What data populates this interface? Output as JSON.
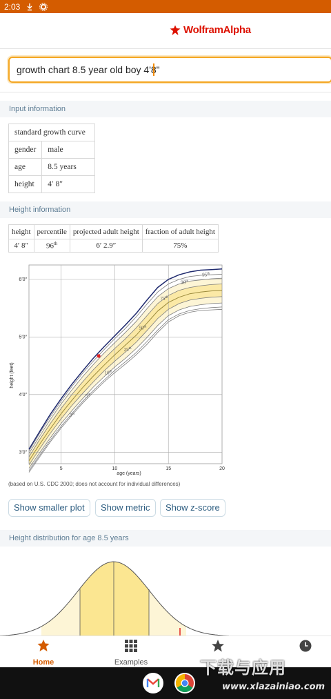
{
  "status": {
    "time": "2:03"
  },
  "logo": {
    "name": "WolframAlpha"
  },
  "search": {
    "value": "growth chart 8.5 year old boy 4'8\""
  },
  "input_pod": {
    "title": "Input information",
    "header": "standard growth curve",
    "rows": [
      {
        "label": "gender",
        "value": "male"
      },
      {
        "label": "age",
        "value": "8.5 years"
      },
      {
        "label": "height",
        "value": "4′ 8″"
      }
    ]
  },
  "height_pod": {
    "title": "Height information",
    "headers": [
      "height",
      "percentile",
      "projected adult height",
      "fraction of adult height"
    ],
    "row": [
      "4′ 8″",
      "96",
      "th",
      "6′ 2.9″",
      "75%"
    ]
  },
  "chart_data": {
    "type": "line",
    "xlabel": "age (years)",
    "ylabel": "height (feet)",
    "xlim": [
      2,
      20
    ],
    "ylim": [
      2.8,
      6.25
    ],
    "xticks": [
      "5",
      "10",
      "15",
      "20"
    ],
    "yticks": [
      "3′0″",
      "4′0″",
      "5′0″",
      "6′0″"
    ],
    "percentile_labels": [
      "3",
      "5",
      "10",
      "25",
      "50",
      "75",
      "90",
      "95"
    ],
    "percentile_suffix": "th",
    "x": [
      2,
      3,
      4,
      5,
      6,
      7,
      8,
      9,
      10,
      11,
      12,
      13,
      14,
      15,
      16,
      17,
      18,
      19,
      20
    ],
    "series": [
      {
        "name": "3",
        "values": [
          2.65,
          2.92,
          3.18,
          3.42,
          3.64,
          3.85,
          4.04,
          4.22,
          4.38,
          4.53,
          4.69,
          4.87,
          5.08,
          5.26,
          5.37,
          5.43,
          5.46,
          5.47,
          5.48
        ]
      },
      {
        "name": "5",
        "values": [
          2.68,
          2.95,
          3.21,
          3.45,
          3.67,
          3.88,
          4.07,
          4.25,
          4.42,
          4.57,
          4.73,
          4.92,
          5.12,
          5.3,
          5.4,
          5.46,
          5.49,
          5.51,
          5.52
        ]
      },
      {
        "name": "10",
        "values": [
          2.72,
          2.99,
          3.25,
          3.5,
          3.72,
          3.93,
          4.13,
          4.31,
          4.48,
          4.63,
          4.8,
          4.99,
          5.2,
          5.37,
          5.47,
          5.53,
          5.56,
          5.58,
          5.59
        ]
      },
      {
        "name": "25",
        "values": [
          2.78,
          3.06,
          3.33,
          3.58,
          3.81,
          4.02,
          4.22,
          4.41,
          4.58,
          4.74,
          4.91,
          5.11,
          5.32,
          5.48,
          5.58,
          5.64,
          5.67,
          5.69,
          5.7
        ]
      },
      {
        "name": "50",
        "values": [
          2.85,
          3.14,
          3.41,
          3.67,
          3.9,
          4.12,
          4.32,
          4.51,
          4.69,
          4.86,
          5.03,
          5.24,
          5.45,
          5.6,
          5.69,
          5.75,
          5.78,
          5.8,
          5.81
        ]
      },
      {
        "name": "75",
        "values": [
          2.92,
          3.22,
          3.5,
          3.76,
          4.0,
          4.22,
          4.43,
          4.62,
          4.8,
          4.97,
          5.16,
          5.37,
          5.58,
          5.72,
          5.81,
          5.86,
          5.89,
          5.91,
          5.92
        ]
      },
      {
        "name": "90",
        "values": [
          2.98,
          3.28,
          3.57,
          3.84,
          4.08,
          4.31,
          4.52,
          4.72,
          4.9,
          5.08,
          5.27,
          5.49,
          5.7,
          5.84,
          5.92,
          5.97,
          5.99,
          6.01,
          6.02
        ]
      },
      {
        "name": "95",
        "values": [
          3.02,
          3.33,
          3.62,
          3.89,
          4.14,
          4.37,
          4.58,
          4.78,
          4.97,
          5.15,
          5.35,
          5.57,
          5.78,
          5.92,
          6.0,
          6.05,
          6.07,
          6.08,
          6.09
        ]
      },
      {
        "name": "97",
        "values": [
          3.05,
          3.36,
          3.66,
          3.93,
          4.18,
          4.41,
          4.63,
          4.83,
          5.02,
          5.21,
          5.41,
          5.64,
          5.86,
          6.0,
          6.08,
          6.13,
          6.16,
          6.17,
          6.18
        ]
      }
    ],
    "point": {
      "x": 8.5,
      "y": 4.67,
      "color": "#e02020"
    },
    "colors": {
      "band": "#fbe9a6",
      "band_light": "#fdf5d6",
      "outer": "#1f2a6e",
      "median": "#9b8a3c",
      "lines": "#7c7c7c"
    },
    "grid": true
  },
  "chart_note": "(based on U.S. CDC 2000; does not account for individual differences)",
  "buttons": {
    "smaller": "Show smaller plot",
    "metric": "Show metric",
    "zscore": "Show z-score"
  },
  "dist_pod": {
    "title": "Height distribution for age 8.5 years"
  },
  "nav": {
    "home": "Home",
    "examples": "Examples"
  },
  "watermark": {
    "text": "下载与应用",
    "url": "www.xlazainiao.com"
  }
}
